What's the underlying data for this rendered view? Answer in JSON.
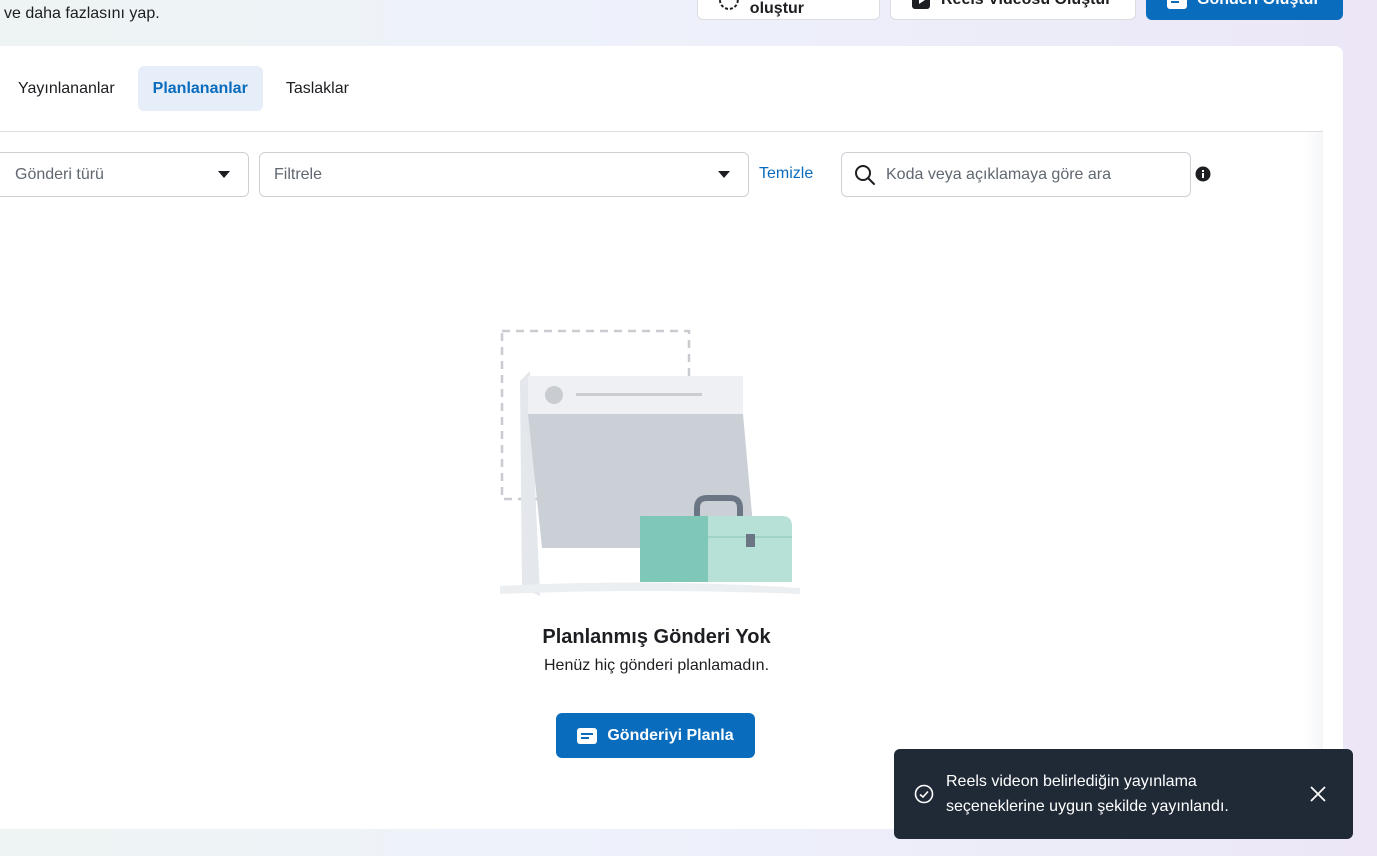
{
  "header": {
    "subtitle": "ve daha fazlasını yap.",
    "story_button": "Hikaye oluştur",
    "reels_button": "Reels Videosu Oluştur",
    "post_button": "Gönderi Oluştur"
  },
  "tabs": [
    {
      "label": "Yayınlananlar",
      "active": false
    },
    {
      "label": "Planlananlar",
      "active": true
    },
    {
      "label": "Taslaklar",
      "active": false
    }
  ],
  "filters": {
    "post_type_placeholder": "Gönderi türü",
    "filter_placeholder": "Filtrele",
    "clear_label": "Temizle",
    "search_placeholder": "Koda veya açıklamaya göre ara"
  },
  "empty_state": {
    "title": "Planlanmış Gönderi Yok",
    "subtitle": "Henüz hiç gönderi planlamadın.",
    "button": "Gönderiyi Planla"
  },
  "toast": {
    "message": "Reels videon belirlediğin yayınlama seçeneklerine uygun şekilde yayınlandı."
  },
  "colors": {
    "primary": "#0a6cbd",
    "active_tab_bg": "#e6eef9",
    "toast_bg": "#1f2a36"
  }
}
